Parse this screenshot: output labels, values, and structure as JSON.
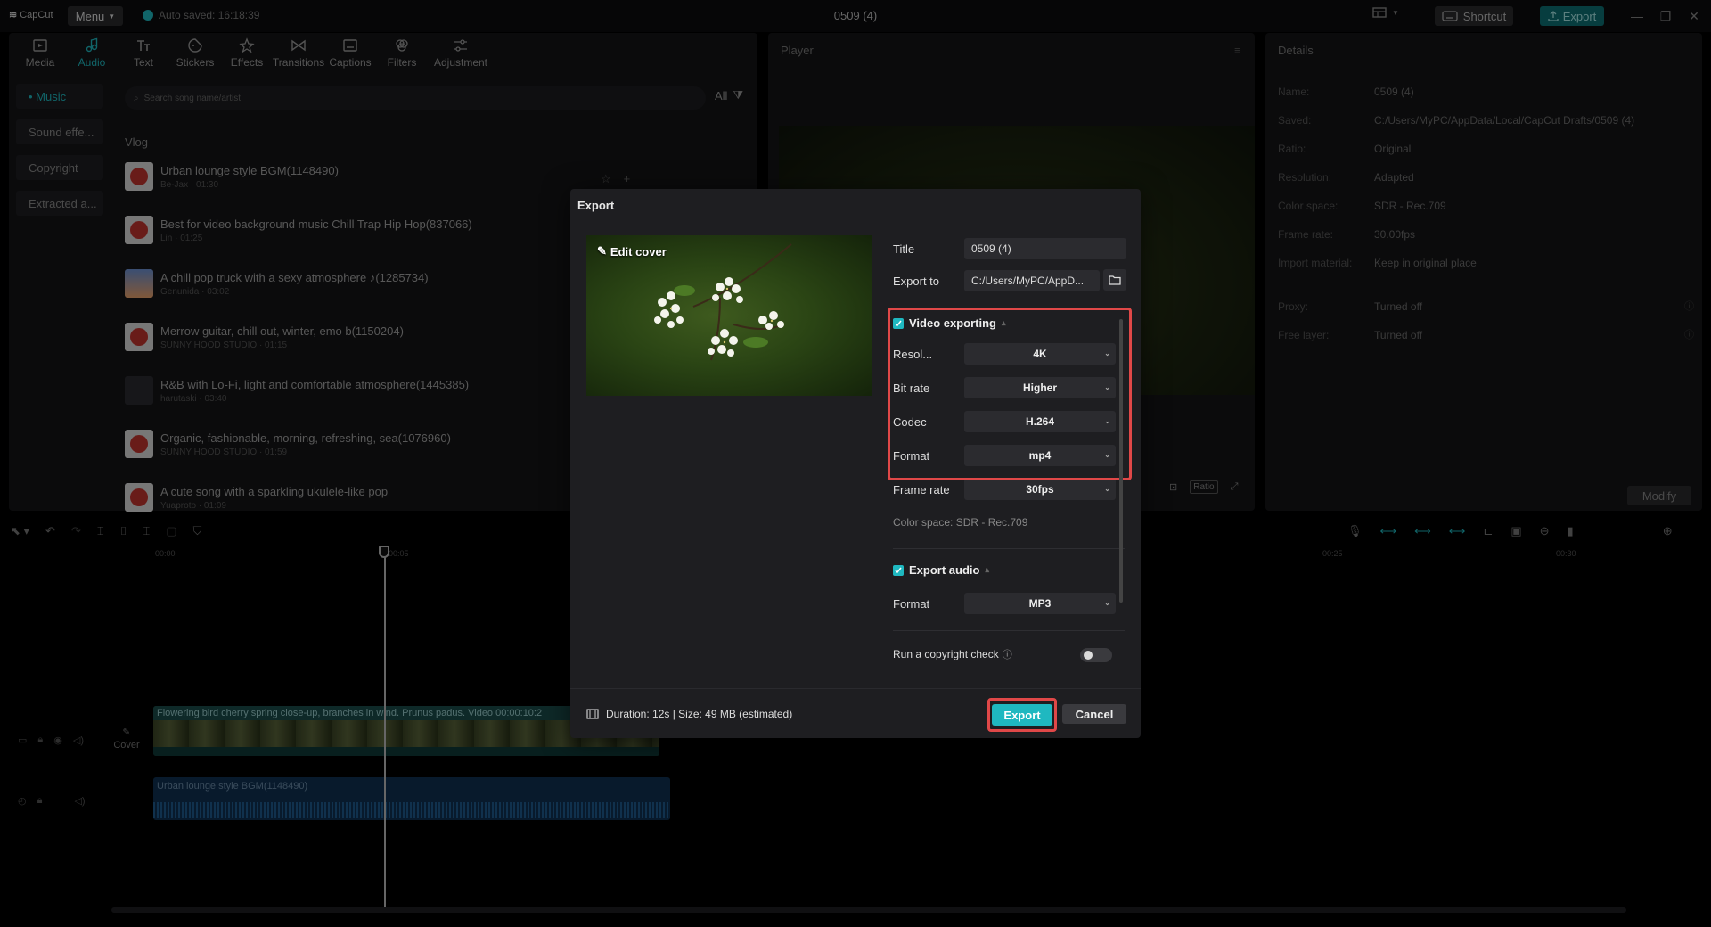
{
  "titlebar": {
    "logo": "CapCut",
    "menu_label": "Menu",
    "autosave": "Auto saved: 16:18:39",
    "project_title": "0509 (4)",
    "shortcut_label": "Shortcut",
    "export_label": "Export"
  },
  "toolbar": {
    "items": [
      {
        "label": "Media",
        "icon": "media-icon"
      },
      {
        "label": "Audio",
        "icon": "audio-icon",
        "active": true
      },
      {
        "label": "Text",
        "icon": "text-icon"
      },
      {
        "label": "Stickers",
        "icon": "stickers-icon"
      },
      {
        "label": "Effects",
        "icon": "effects-icon"
      },
      {
        "label": "Transitions",
        "icon": "transitions-icon"
      },
      {
        "label": "Captions",
        "icon": "captions-icon"
      },
      {
        "label": "Filters",
        "icon": "filters-icon"
      },
      {
        "label": "Adjustment",
        "icon": "adjustment-icon"
      }
    ]
  },
  "audio_panel": {
    "categories": [
      "• Music",
      "Sound effe...",
      "Copyright",
      "Extracted a..."
    ],
    "search_placeholder": "Search song name/artist",
    "filter_label": "All",
    "section_label": "Vlog",
    "songs": [
      {
        "title": "Urban lounge style BGM(1148490)",
        "sub": "Be-Jax · 01:30"
      },
      {
        "title": "Best for video background music Chill Trap Hip Hop(837066)",
        "sub": "Lin · 01:25"
      },
      {
        "title": "A chill pop truck with a sexy atmosphere ♪(1285734)",
        "sub": "Genunida · 03:02"
      },
      {
        "title": "Merrow guitar, chill out, winter, emo b(1150204)",
        "sub": "SUNNY HOOD STUDIO · 01:15"
      },
      {
        "title": "R&B with Lo-Fi, light and comfortable atmosphere(1445385)",
        "sub": "harutaski · 03:40"
      },
      {
        "title": "Organic, fashionable, morning, refreshing, sea(1076960)",
        "sub": "SUNNY HOOD STUDIO · 01:59"
      },
      {
        "title": "A cute song with a sparkling ukulele-like pop",
        "sub": "Yuaproto · 01:09"
      }
    ]
  },
  "player": {
    "title": "Player",
    "ratio_label": "Ratio"
  },
  "details": {
    "title": "Details",
    "rows": [
      {
        "label": "Name:",
        "value": "0509 (4)"
      },
      {
        "label": "Saved:",
        "value": "C:/Users/MyPC/AppData/Local/CapCut Drafts/0509 (4)"
      },
      {
        "label": "Ratio:",
        "value": "Original"
      },
      {
        "label": "Resolution:",
        "value": "Adapted"
      },
      {
        "label": "Color space:",
        "value": "SDR - Rec.709"
      },
      {
        "label": "Frame rate:",
        "value": "30.00fps"
      },
      {
        "label": "Import material:",
        "value": "Keep in original place"
      }
    ],
    "rows2": [
      {
        "label": "Proxy:",
        "value": "Turned off"
      },
      {
        "label": "Free layer:",
        "value": "Turned off"
      }
    ],
    "modify_label": "Modify"
  },
  "timeline": {
    "ruler": [
      "00:00",
      "00:05",
      "00:25",
      "00:30"
    ],
    "video_clip_label": "Flowering bird cherry spring close-up, branches in wind. Prunus padus. Video  00:00:10:2",
    "audio_clip_label": "Urban lounge style BGM(1148490)",
    "cover_label": "Cover"
  },
  "export_dialog": {
    "title": "Export",
    "edit_cover_label": "Edit cover",
    "title_label": "Title",
    "title_value": "0509 (4)",
    "export_to_label": "Export to",
    "export_to_value": "C:/Users/MyPC/AppD...",
    "video_section": "Video exporting",
    "video_settings": [
      {
        "label": "Resol...",
        "value": "4K"
      },
      {
        "label": "Bit rate",
        "value": "Higher"
      },
      {
        "label": "Codec",
        "value": "H.264"
      },
      {
        "label": "Format",
        "value": "mp4"
      },
      {
        "label": "Frame rate",
        "value": "30fps"
      }
    ],
    "color_space_note": "Color space: SDR - Rec.709",
    "audio_section": "Export audio",
    "audio_format_label": "Format",
    "audio_format_value": "MP3",
    "copyright_label": "Run a copyright check",
    "footer_info": "Duration: 12s | Size: 49 MB (estimated)",
    "export_label": "Export",
    "cancel_label": "Cancel"
  },
  "colors": {
    "accent": "#1fb8c0",
    "highlight": "#e04848",
    "panel_bg": "#141416",
    "dialog_bg": "#1e1e21"
  }
}
